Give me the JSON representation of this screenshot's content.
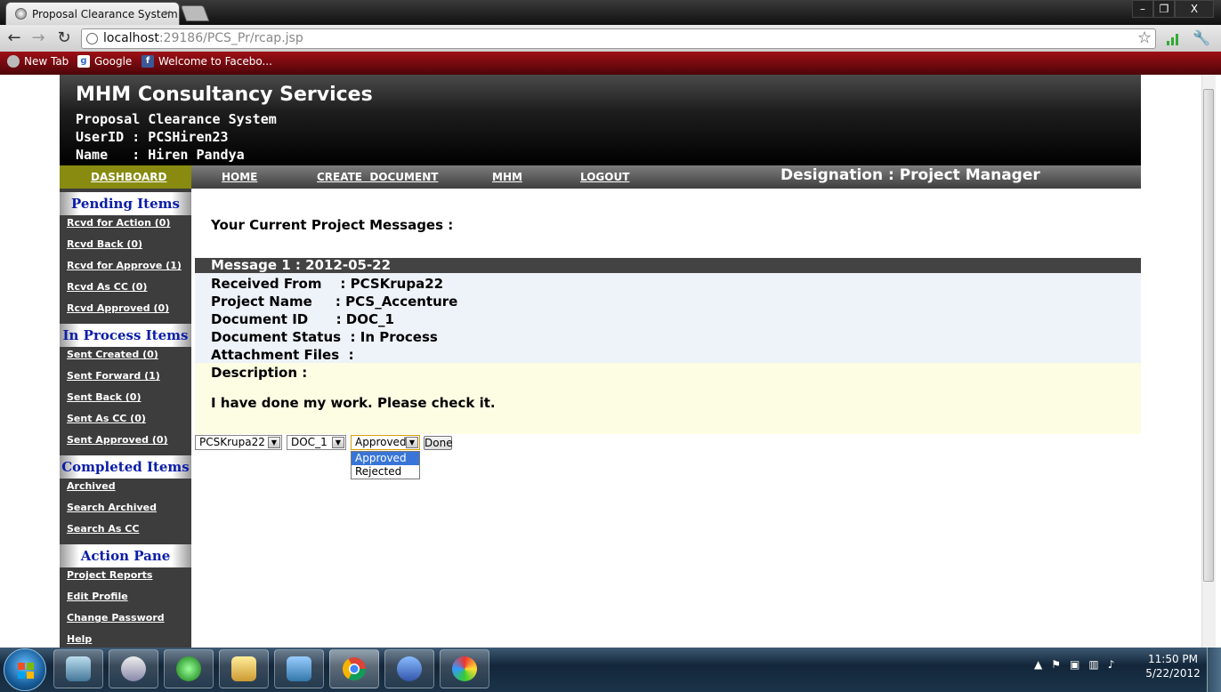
{
  "browser": {
    "tab_title": "Proposal Clearance System",
    "tab_close": "×",
    "url_host": "localhost",
    "url_path": ":29186/PCS_Pr/rcap.jsp",
    "window_buttons": [
      "–",
      "❐",
      "X"
    ],
    "bookmarks": [
      {
        "label": "New Tab",
        "icon": "globe-icon"
      },
      {
        "label": "Google",
        "icon": "google-icon"
      },
      {
        "label": "Welcome to Facebo...",
        "icon": "facebook-icon"
      }
    ]
  },
  "header": {
    "company": "MHM Consultancy Services",
    "system": "Proposal Clearance System",
    "userid_line": "UserID : PCSHiren23",
    "name_line": "Name   : Hiren Pandya"
  },
  "menu": {
    "dashboard": "DASHBOARD",
    "home": "HOME",
    "create_document": "CREATE  DOCUMENT",
    "mhm": "MHM",
    "logout": "LOGOUT",
    "designation": "Designation : Project Manager"
  },
  "sidebar": {
    "pending_title": "Pending Items",
    "pending": [
      "Rcvd for Action (0)",
      "Rcvd Back (0)",
      "Rcvd for Approve (1)",
      "Rcvd As CC (0)",
      "Rcvd Approved (0)"
    ],
    "inprocess_title": "In Process Items",
    "inprocess": [
      "Sent Created (0)",
      "Sent Forward (1)",
      "Sent Back (0)",
      "Sent As CC (0)",
      "Sent Approved (0)"
    ],
    "completed_title": "Completed Items",
    "completed": [
      "Archived",
      "Search Archived",
      "Search As CC"
    ],
    "action_title": "Action Pane",
    "action": [
      "Project Reports",
      "Edit Profile",
      "Change Password",
      "Help"
    ]
  },
  "main": {
    "heading": "Your Current Project Messages :",
    "message_title": "Message 1 : 2012-05-22",
    "rows": [
      "Received From    : PCSKrupa22",
      "Project Name     : PCS_Accenture",
      "Document ID      : DOC_1",
      "Document Status  : In Process",
      "Attachment Files  :"
    ],
    "description_label": "Description :",
    "description_text": "I have done my work. Please check it.",
    "select_user": "PCSKrupa22",
    "select_doc": "DOC_1",
    "select_status": "Approved",
    "status_options": [
      "Approved",
      "Rejected"
    ],
    "done_label": "Done"
  },
  "taskbar": {
    "time": "11:50 PM",
    "date": "5/22/2012",
    "apps": [
      "virtualbox-icon",
      "outlook-icon",
      "ie-icon",
      "explorer-icon",
      "photo-viewer-icon",
      "chrome-icon",
      "dolphin-icon",
      "paint-icon"
    ]
  }
}
